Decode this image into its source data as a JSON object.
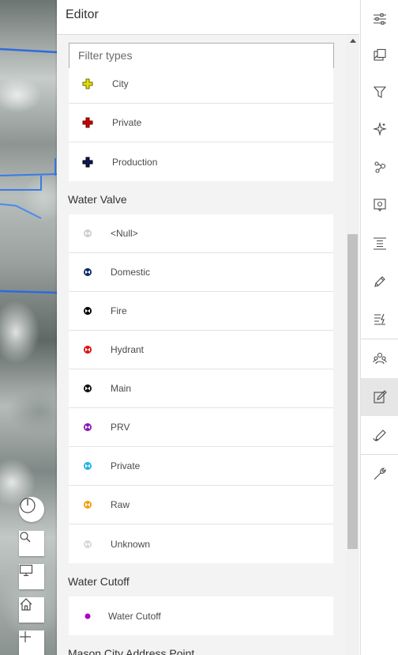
{
  "panel": {
    "title": "Editor",
    "filter_placeholder": "Filter types"
  },
  "groups": [
    {
      "name": "",
      "items": [
        {
          "label": "City",
          "color": "#e6e000",
          "symbol": "cross"
        },
        {
          "label": "Private",
          "color": "#d00000",
          "symbol": "cross"
        },
        {
          "label": "Production",
          "color": "#0a1a5c",
          "symbol": "cross"
        }
      ]
    },
    {
      "name": "Water Valve",
      "items": [
        {
          "label": "<Null>",
          "color": "#cfcfcf",
          "symbol": "valve"
        },
        {
          "label": "Domestic",
          "color": "#0b2a6b",
          "symbol": "valve"
        },
        {
          "label": "Fire",
          "color": "#000000",
          "symbol": "valve"
        },
        {
          "label": "Hydrant",
          "color": "#e01010",
          "symbol": "valve"
        },
        {
          "label": "Main",
          "color": "#101010",
          "symbol": "valve"
        },
        {
          "label": "PRV",
          "color": "#8a18b0",
          "symbol": "valve"
        },
        {
          "label": "Private",
          "color": "#1eb4e6",
          "symbol": "valve"
        },
        {
          "label": "Raw",
          "color": "#f0a010",
          "symbol": "valve"
        },
        {
          "label": "Unknown",
          "color": "#d8d8d8",
          "symbol": "valve"
        }
      ]
    },
    {
      "name": "Water Cutoff",
      "items": [
        {
          "label": "Water Cutoff",
          "color": "#b000c8",
          "symbol": "dot"
        }
      ]
    },
    {
      "name": "Mason City Address Point",
      "items": []
    }
  ],
  "actions": [
    {
      "name": "layer-properties-icon"
    },
    {
      "name": "basemap-icon"
    },
    {
      "name": "filter-icon"
    },
    {
      "name": "effects-icon"
    },
    {
      "name": "analysis-icon"
    },
    {
      "name": "configure-pop-ups-icon"
    },
    {
      "name": "legend-icon"
    },
    {
      "name": "sketch-icon"
    },
    {
      "name": "map-properties-icon"
    },
    {
      "name": "share-icon"
    },
    {
      "name": "edit-icon",
      "active": true
    },
    {
      "name": "sketch-markup-icon"
    },
    {
      "name": "tools-icon"
    }
  ]
}
